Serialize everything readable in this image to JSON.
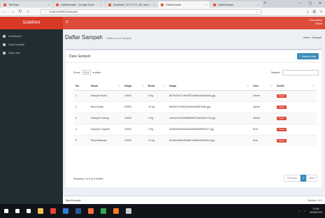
{
  "browser": {
    "tabs": [
      {
        "label": "Tab Baru",
        "active": false
      },
      {
        "label": "DataSampah - Google Drive",
        "active": false
      },
      {
        "label": "localhost / 127.0.0.1 / db_sam...",
        "active": false
      },
      {
        "label": "DataSampah",
        "active": true
      },
      {
        "label": "DataSampah",
        "active": false
      }
    ],
    "url": "localhost/8000/sampah",
    "window_controls": [
      "–",
      "▢",
      "✕"
    ]
  },
  "app": {
    "brand": "SAMPAH",
    "sidebar": [
      {
        "label": "Dashboard",
        "icon": "dashboard-icon"
      },
      {
        "label": "Data Sampah",
        "icon": "trash-icon"
      },
      {
        "label": "Data User",
        "icon": "user-icon"
      }
    ],
    "user": {
      "name": "User Admin",
      "role": "Online"
    }
  },
  "page": {
    "title": "Daftar Sampah",
    "subtitle": "Daftar semua Sampah",
    "breadcrumb": "Home › Sampah"
  },
  "box": {
    "title": "Data Sampah",
    "add_button": "+ Tambah Data"
  },
  "table_controls": {
    "show_label": "Show",
    "show_value": "10",
    "entries_label": "entries",
    "search_label": "Search:"
  },
  "table": {
    "headers": [
      "No.",
      "Nama",
      "Harga",
      "Berat",
      "Image",
      "User",
      "Delete"
    ],
    "rows": [
      {
        "no": "1",
        "nama": "Sampah Botol",
        "harga": "10000",
        "berat": "3 Kg",
        "image": "5679c3dc77db4f2ff72dd59cd4a3bed4.jpg",
        "user": "Admin",
        "delete": "Hapus"
      },
      {
        "no": "2",
        "nama": "Besi Rusak",
        "harga": "20000",
        "berat": "10 Kg",
        "image": "f6f95e07206f1622dbb0968f70dfe.jpg",
        "user": "Admin",
        "delete": "Hapus"
      },
      {
        "no": "3",
        "nama": "Sampah Kaleng",
        "harga": "10000",
        "berat": "3 Kg",
        "image": "cae4ce1140da2f8b89627aa2b49c72e.jpg",
        "user": "Admin",
        "delete": "Hapus"
      },
      {
        "no": "4",
        "nama": "Sampah Organik",
        "harga": "10000",
        "berat": "3 Kg",
        "image": "42a8ebe959d3d2ad3d5e69ff954e27.jpg",
        "user": "Evet",
        "delete": "Hapus"
      },
      {
        "no": "5",
        "nama": "Sisa Makanan",
        "harga": "10000",
        "berat": "10 Kg",
        "image": "2b1a0c4d6e4f5d6b7c8d9e0f1a2b3c4.jpg",
        "user": "Evet",
        "delete": "Hapus"
      }
    ]
  },
  "pagination": {
    "info": "Showing 1 to 5 of 5 entries",
    "prev": "Previous",
    "page": "1",
    "next": "Next"
  },
  "footer": {
    "left": "BankSampah",
    "right": "Version 1.0.0"
  },
  "taskbar": {
    "time": "10:56",
    "date": "26/06/2019",
    "icons": [
      {
        "name": "start-icon",
        "color": "#ffffff"
      },
      {
        "name": "search-icon",
        "color": "#ffffff"
      },
      {
        "name": "taskview-icon",
        "color": "#ffffff"
      },
      {
        "name": "folder-icon",
        "color": "#f2c14e"
      },
      {
        "name": "chrome-icon",
        "color": "#e94235"
      },
      {
        "name": "store-icon",
        "color": "#2d7dd2"
      },
      {
        "name": "word-icon",
        "color": "#2b579a"
      },
      {
        "name": "firefox-icon",
        "color": "#ff7139"
      },
      {
        "name": "app-icon",
        "color": "#34a853"
      },
      {
        "name": "xampp-icon",
        "color": "#fb7a24"
      },
      {
        "name": "terminal-icon",
        "color": "#cccccc"
      }
    ]
  }
}
